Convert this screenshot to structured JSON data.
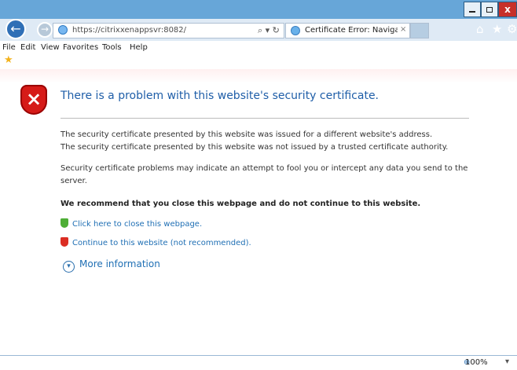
{
  "browser": {
    "address": {
      "url": "https://citrixxenappsvr:8082/"
    },
    "tab": {
      "label": "Certificate Error: Navigation...",
      "close": "×"
    },
    "buttons": {
      "back": "←",
      "forward": "→",
      "search_refresh": "⌕ ▾ ↻"
    },
    "window_controls": {
      "minimize": "",
      "maximize": "",
      "close": "x"
    },
    "toolbar_icons": {
      "home": "⌂",
      "favorites": "★",
      "tools": "⚙"
    }
  },
  "menu": {
    "items": [
      "File",
      "Edit",
      "View",
      "Favorites",
      "Tools",
      "Help"
    ]
  },
  "page": {
    "title": "There is a problem with this website's security certificate.",
    "paragraph1": "The security certificate presented by this website was issued for a different website's address.",
    "paragraph2": "The security certificate presented by this website was not issued by a trusted certificate authority.",
    "paragraph3": "Security certificate problems may indicate an attempt to fool you or intercept any data you send to the server.",
    "recommendation": "We recommend that you close this webpage and do not continue to this website.",
    "close_link": "Click here to close this webpage.",
    "continue_link": "Continue to this website (not recommended).",
    "more_info": "More information"
  },
  "status": {
    "zoom": "100%"
  },
  "colors": {
    "frame": "#67a6d8",
    "link": "#1f6fb4",
    "title": "#1f5ea8",
    "warning": "#d61b18"
  },
  "icons": {
    "back": "back-arrow-icon",
    "forward": "forward-arrow-icon",
    "ie": "internet-explorer-icon",
    "shield": "security-warning-shield-icon",
    "ok": "green-shield-icon",
    "warning": "red-shield-icon",
    "info": "chevron-down-circle-icon",
    "zoom": "zoom-icon"
  }
}
